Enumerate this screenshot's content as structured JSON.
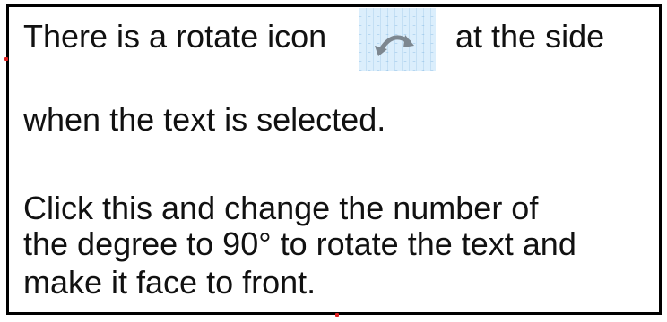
{
  "instruction": {
    "line1_before_icon": "There is a rotate icon",
    "line1_after_icon": "at the side",
    "line2": "when the text is selected.",
    "line3": "Click this and change the number of",
    "line4": "the degree to 90° to rotate the text and",
    "line5": "make it face to front."
  },
  "icons": {
    "rotate": "rotate-icon"
  },
  "colors": {
    "border": "#000000",
    "selection_handle": "#e02020",
    "icon_background": "#dbeefc"
  }
}
